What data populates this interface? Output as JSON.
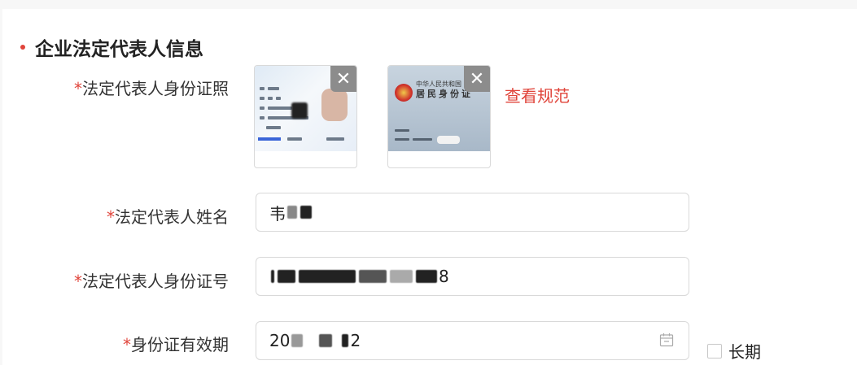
{
  "section": {
    "title": "企业法定代表人信息"
  },
  "fields": {
    "id_photo": {
      "required_mark": "*",
      "label": "法定代表人身份证照",
      "spec_link": "查看规范",
      "front_card": {
        "close_icon": "close-icon",
        "text_lines": [
          "韦小宝",
          "男",
          "12 ×20 ×",
          "山山山4号",
          "公民身份证号码",
          "11284",
          "48243"
        ]
      },
      "back_card": {
        "close_icon": "close-icon",
        "country_text": "中华人民共和国",
        "card_title": "居民身份证"
      }
    },
    "name": {
      "required_mark": "*",
      "label": "法定代表人姓名",
      "value_visible_start": "韦",
      "value_visible_end": ""
    },
    "id_number": {
      "required_mark": "*",
      "label": "法定代表人身份证号",
      "value_visible_end": "8"
    },
    "validity": {
      "required_mark": "*",
      "label": "身份证有效期",
      "value_visible_start": "20",
      "value_visible_end": "2",
      "calendar_icon": "calendar-icon",
      "long_term_label": "长期",
      "long_term_checked": false
    }
  },
  "colors": {
    "accent": "#e0443a",
    "border": "#d9d9d9",
    "close_bg": "#8c8c8c"
  }
}
